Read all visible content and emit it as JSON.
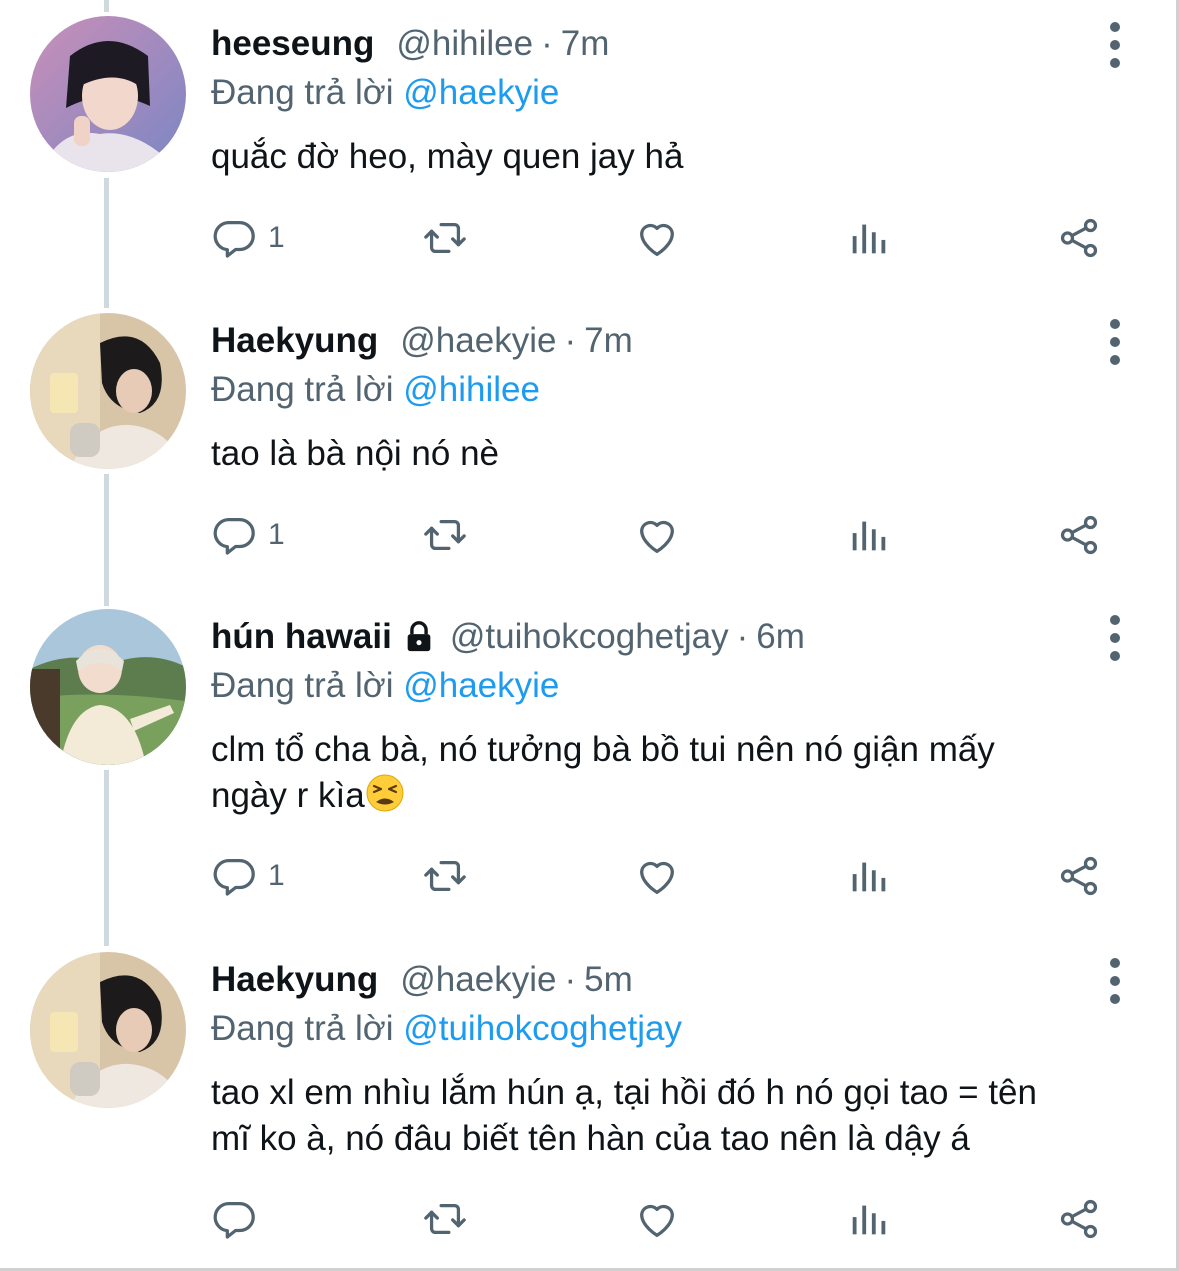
{
  "tweets": [
    {
      "name": "heeseung",
      "handle": "@hihilee",
      "dot": "·",
      "time": "7m",
      "reply_prefix": "Đang trả lời",
      "reply_to": "@haekyie",
      "text": "quắc đờ heo, mày quen jay hả",
      "reply_count": "1",
      "avatar": "avatar-heeseung"
    },
    {
      "name": "Haekyung",
      "handle": "@haekyie",
      "dot": "·",
      "time": "7m",
      "reply_prefix": "Đang trả lời",
      "reply_to": "@hihilee",
      "text": "tao là bà nội nó nè",
      "reply_count": "1",
      "avatar": "avatar-haekyung"
    },
    {
      "name": "hún hawaii",
      "handle": "@tuihokcoghetjay",
      "dot": "·",
      "time": "6m",
      "reply_prefix": "Đang trả lời",
      "reply_to": "@haekyie",
      "text_line1": "clm tổ cha bà, nó tưởng bà bồ tui nên nó giận mấy",
      "text_line2": "ngày r kìa",
      "emoji": "tired-face-emoji",
      "reply_count": "1",
      "protected": true,
      "avatar": "avatar-hun-hawaii"
    },
    {
      "name": "Haekyung",
      "handle": "@haekyie",
      "dot": "·",
      "time": "5m",
      "reply_prefix": "Đang trả lời",
      "reply_to": "@tuihokcoghetjay",
      "text_line1": "tao xl em nhìu lắm hún ạ, tại hồi đó h nó gọi tao = tên",
      "text_line2": "mĩ ko à, nó đâu biết tên hàn của tao nên là dậy á",
      "reply_count": "",
      "avatar": "avatar-haekyung"
    }
  ],
  "icons": [
    "reply-icon",
    "retweet-icon",
    "like-icon",
    "views-icon",
    "share-icon",
    "more-icon",
    "lock-icon"
  ],
  "colors": {
    "text": "#0f1419",
    "secondary": "#536471",
    "mention": "#1d9bf0",
    "thread_line": "#cfd9de"
  }
}
